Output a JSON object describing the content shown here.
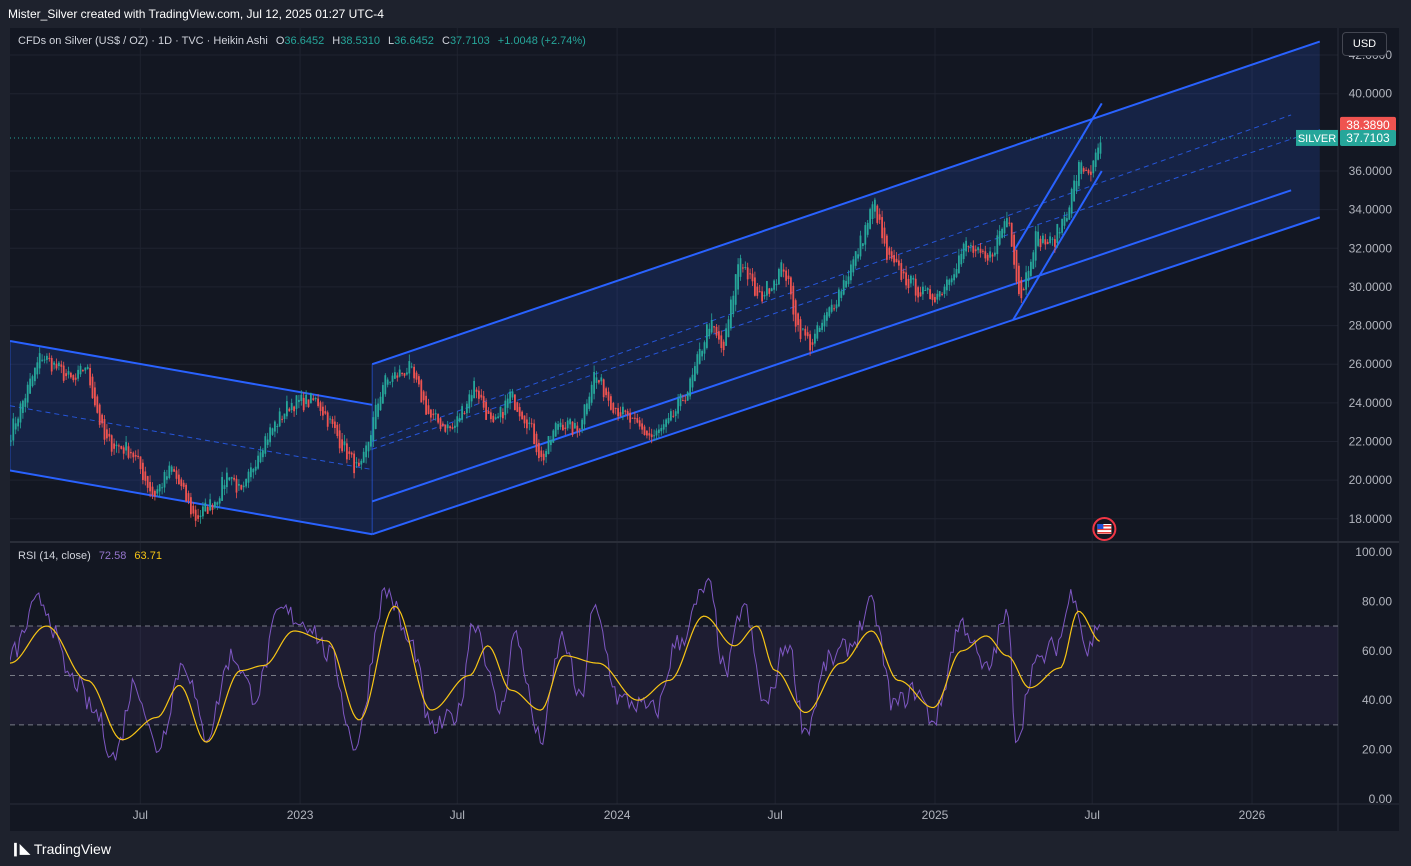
{
  "header": {
    "caption": "Mister_Silver created with TradingView.com, Jul 12, 2025 01:27 UTC-4"
  },
  "legend": {
    "symbol": "CFDs on Silver (US$ / OZ) · 1D · TVC · Heikin Ashi",
    "open_label": "O",
    "open": "36.6452",
    "high_label": "H",
    "high": "38.5310",
    "low_label": "L",
    "low": "36.6452",
    "close_label": "C",
    "close": "37.7103",
    "change": "+1.0048 (+2.74%)"
  },
  "currency": "USD",
  "rsi_legend": {
    "label": "RSI (14, close)",
    "rsi": "72.58",
    "ma": "63.71"
  },
  "footer": {
    "brand": "TradingView"
  },
  "colors": {
    "up": "#26a69a",
    "down": "#ef5350",
    "channel": "#2962ff",
    "rsi": "#7e57c2",
    "rsi_ma": "#f7c515",
    "background": "#131722"
  },
  "chart_data": [
    {
      "type": "candlestick",
      "style": "Heikin Ashi",
      "symbol": "SILVER",
      "price_axis": {
        "ticks": [
          "42.0000",
          "40.0000",
          "36.0000",
          "34.0000",
          "32.0000",
          "30.0000",
          "28.0000",
          "26.0000",
          "24.0000",
          "22.0000",
          "20.0000",
          "18.0000"
        ],
        "range": [
          16.8,
          43.4
        ]
      },
      "time_axis": {
        "ticks": [
          "Jul",
          "2023",
          "Jul",
          "2024",
          "Jul",
          "2025",
          "Jul",
          "2026"
        ],
        "range": [
          "2022-02-01",
          "2026-04-10"
        ]
      },
      "labels": {
        "high_tag": "38.3890",
        "symbol_tag": "SILVER",
        "last_tag": "37.7103"
      },
      "last_price": 37.7103,
      "high_price": 38.389,
      "series": [
        {
          "name": "SILVER",
          "points": [
            [
              "2022-02-01",
              22.5
            ],
            [
              "2022-03-08",
              26.5
            ],
            [
              "2022-04-15",
              25.0
            ],
            [
              "2022-04-28",
              26.0
            ],
            [
              "2022-05-20",
              22.0
            ],
            [
              "2022-06-20",
              21.5
            ],
            [
              "2022-07-15",
              19.2
            ],
            [
              "2022-08-05",
              20.6
            ],
            [
              "2022-09-01",
              18.0
            ],
            [
              "2022-09-25",
              19.0
            ],
            [
              "2022-10-10",
              20.5
            ],
            [
              "2022-10-25",
              19.1
            ],
            [
              "2022-11-15",
              21.8
            ],
            [
              "2022-12-20",
              24.0
            ],
            [
              "2023-01-20",
              24.1
            ],
            [
              "2023-02-28",
              21.0
            ],
            [
              "2023-03-10",
              20.3
            ],
            [
              "2023-04-05",
              25.0
            ],
            [
              "2023-05-05",
              25.8
            ],
            [
              "2023-05-30",
              23.2
            ],
            [
              "2023-06-25",
              22.6
            ],
            [
              "2023-07-20",
              25.0
            ],
            [
              "2023-08-10",
              22.6
            ],
            [
              "2023-08-30",
              24.4
            ],
            [
              "2023-09-20",
              23.0
            ],
            [
              "2023-10-05",
              21.0
            ],
            [
              "2023-10-25",
              23.1
            ],
            [
              "2023-11-15",
              22.5
            ],
            [
              "2023-12-04",
              25.5
            ],
            [
              "2023-12-25",
              24.0
            ],
            [
              "2024-01-20",
              22.8
            ],
            [
              "2024-02-10",
              22.2
            ],
            [
              "2024-02-28",
              22.9
            ],
            [
              "2024-03-25",
              25.0
            ],
            [
              "2024-04-15",
              28.2
            ],
            [
              "2024-05-01",
              26.6
            ],
            [
              "2024-05-20",
              31.7
            ],
            [
              "2024-06-10",
              29.3
            ],
            [
              "2024-07-10",
              31.1
            ],
            [
              "2024-07-25",
              28.0
            ],
            [
              "2024-08-10",
              27.0
            ],
            [
              "2024-09-01",
              28.8
            ],
            [
              "2024-10-01",
              31.6
            ],
            [
              "2024-10-22",
              34.4
            ],
            [
              "2024-11-05",
              31.5
            ],
            [
              "2024-11-25",
              30.5
            ],
            [
              "2024-12-20",
              29.5
            ],
            [
              "2025-01-05",
              29.7
            ],
            [
              "2025-02-05",
              32.2
            ],
            [
              "2025-03-01",
              31.2
            ],
            [
              "2025-03-25",
              33.8
            ],
            [
              "2025-04-08",
              29.3
            ],
            [
              "2025-04-25",
              32.6
            ],
            [
              "2025-05-15",
              32.2
            ],
            [
              "2025-06-01",
              34.0
            ],
            [
              "2025-06-15",
              36.2
            ],
            [
              "2025-06-30",
              36.0
            ],
            [
              "2025-07-11",
              37.7103
            ]
          ]
        }
      ],
      "channels": [
        {
          "name": "descending channel",
          "upper": [
            [
              "2022-02-01",
              27.2
            ],
            [
              "2023-03-25",
              23.9
            ]
          ],
          "lower": [
            [
              "2022-02-01",
              20.5
            ],
            [
              "2023-03-25",
              17.2
            ]
          ]
        },
        {
          "name": "ascending channel",
          "upper": [
            [
              "2023-03-25",
              26.0
            ],
            [
              "2026-03-20",
              42.7
            ]
          ],
          "lower": [
            [
              "2023-03-25",
              17.2
            ],
            [
              "2026-03-20",
              33.6
            ]
          ],
          "inner_lower": [
            [
              "2023-03-25",
              18.9
            ],
            [
              "2026-02-15",
              35.0
            ]
          ]
        },
        {
          "name": "rising wedge channel",
          "upper": [
            [
              "2025-04-01",
              31.8
            ],
            [
              "2025-07-12",
              39.5
            ]
          ],
          "lower": [
            [
              "2025-04-01",
              28.3
            ],
            [
              "2025-07-12",
              36.0
            ]
          ]
        }
      ]
    },
    {
      "type": "line",
      "title": "RSI (14, close)",
      "y_axis": {
        "ticks": [
          "100.00",
          "80.00",
          "60.00",
          "40.00",
          "20.00",
          "0.00"
        ],
        "range": [
          -2,
          104
        ]
      },
      "bands": {
        "upper": 70,
        "middle": 50,
        "lower": 30
      },
      "series": [
        {
          "name": "RSI",
          "points": [
            [
              "2022-02-01",
              58
            ],
            [
              "2022-03-08",
              80
            ],
            [
              "2022-04-15",
              48
            ],
            [
              "2022-05-10",
              35
            ],
            [
              "2022-06-01",
              17
            ],
            [
              "2022-06-25",
              47
            ],
            [
              "2022-07-20",
              21
            ],
            [
              "2022-08-20",
              55
            ],
            [
              "2022-09-15",
              26
            ],
            [
              "2022-10-15",
              58
            ],
            [
              "2022-11-10",
              42
            ],
            [
              "2022-12-10",
              76
            ],
            [
              "2023-01-10",
              71
            ],
            [
              "2023-02-05",
              58
            ],
            [
              "2023-03-05",
              22
            ],
            [
              "2023-04-10",
              84
            ],
            [
              "2023-05-10",
              62
            ],
            [
              "2023-06-01",
              28
            ],
            [
              "2023-07-01",
              34
            ],
            [
              "2023-07-20",
              72
            ],
            [
              "2023-08-20",
              36
            ],
            [
              "2023-09-05",
              66
            ],
            [
              "2023-10-05",
              24
            ],
            [
              "2023-10-30",
              65
            ],
            [
              "2023-11-20",
              40
            ],
            [
              "2023-12-05",
              76
            ],
            [
              "2024-01-05",
              40
            ],
            [
              "2024-02-15",
              36
            ],
            [
              "2024-03-10",
              63
            ],
            [
              "2024-04-15",
              86
            ],
            [
              "2024-05-05",
              51
            ],
            [
              "2024-05-25",
              78
            ],
            [
              "2024-06-20",
              38
            ],
            [
              "2024-07-15",
              63
            ],
            [
              "2024-08-05",
              28
            ],
            [
              "2024-09-01",
              56
            ],
            [
              "2024-09-25",
              62
            ],
            [
              "2024-10-20",
              78
            ],
            [
              "2024-11-15",
              38
            ],
            [
              "2024-12-10",
              44
            ],
            [
              "2024-12-30",
              32
            ],
            [
              "2025-02-01",
              71
            ],
            [
              "2025-03-01",
              52
            ],
            [
              "2025-03-25",
              74
            ],
            [
              "2025-04-05",
              25
            ],
            [
              "2025-04-25",
              54
            ],
            [
              "2025-05-20",
              62
            ],
            [
              "2025-06-10",
              84
            ],
            [
              "2025-06-25",
              60
            ],
            [
              "2025-07-11",
              72.58
            ]
          ]
        },
        {
          "name": "MA",
          "points": [
            [
              "2022-02-01",
              55
            ],
            [
              "2022-03-15",
              70
            ],
            [
              "2022-05-01",
              48
            ],
            [
              "2022-06-10",
              24
            ],
            [
              "2022-07-20",
              33
            ],
            [
              "2022-08-15",
              46
            ],
            [
              "2022-09-15",
              23
            ],
            [
              "2022-10-25",
              52
            ],
            [
              "2022-11-20",
              54
            ],
            [
              "2022-12-25",
              68
            ],
            [
              "2023-02-01",
              64
            ],
            [
              "2023-03-10",
              32
            ],
            [
              "2023-04-20",
              78
            ],
            [
              "2023-06-01",
              36
            ],
            [
              "2023-07-15",
              50
            ],
            [
              "2023-08-05",
              62
            ],
            [
              "2023-09-01",
              44
            ],
            [
              "2023-10-05",
              36
            ],
            [
              "2023-11-01",
              58
            ],
            [
              "2023-12-10",
              55
            ],
            [
              "2024-01-25",
              40
            ],
            [
              "2024-03-01",
              48
            ],
            [
              "2024-04-10",
              74
            ],
            [
              "2024-05-15",
              62
            ],
            [
              "2024-06-10",
              70
            ],
            [
              "2024-07-01",
              52
            ],
            [
              "2024-08-05",
              35
            ],
            [
              "2024-09-15",
              55
            ],
            [
              "2024-10-20",
              68
            ],
            [
              "2024-11-20",
              48
            ],
            [
              "2024-12-30",
              37
            ],
            [
              "2025-02-01",
              60
            ],
            [
              "2025-03-01",
              66
            ],
            [
              "2025-03-25",
              58
            ],
            [
              "2025-04-20",
              45
            ],
            [
              "2025-05-25",
              53
            ],
            [
              "2025-06-15",
              76
            ],
            [
              "2025-07-11",
              63.71
            ]
          ]
        }
      ]
    }
  ]
}
